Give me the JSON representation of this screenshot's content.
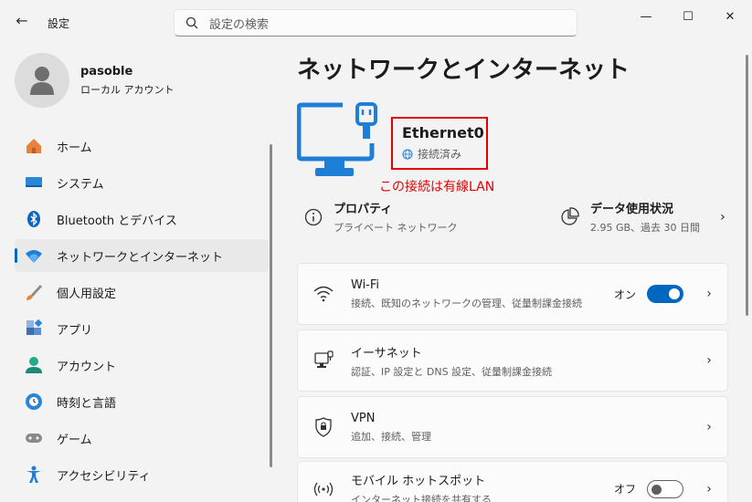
{
  "window": {
    "title": "設定",
    "back_icon": "arrow-left-icon",
    "minimize_icon": "minimize-icon",
    "maximize_icon": "maximize-icon",
    "close_icon": "close-icon"
  },
  "search": {
    "placeholder": "設定の検索",
    "icon": "search-icon"
  },
  "user": {
    "name": "pasoble",
    "account_type": "ローカル アカウント"
  },
  "nav": {
    "items": [
      {
        "label": "ホーム",
        "icon": "home-icon",
        "active": false
      },
      {
        "label": "システム",
        "icon": "system-icon",
        "active": false
      },
      {
        "label": "Bluetooth とデバイス",
        "icon": "bluetooth-icon",
        "active": false
      },
      {
        "label": "ネットワークとインターネット",
        "icon": "wifi-network-icon",
        "active": true
      },
      {
        "label": "個人用設定",
        "icon": "brush-icon",
        "active": false
      },
      {
        "label": "アプリ",
        "icon": "apps-icon",
        "active": false
      },
      {
        "label": "アカウント",
        "icon": "account-icon",
        "active": false
      },
      {
        "label": "時刻と言語",
        "icon": "clock-globe-icon",
        "active": false
      },
      {
        "label": "ゲーム",
        "icon": "gamepad-icon",
        "active": false
      },
      {
        "label": "アクセシビリティ",
        "icon": "accessibility-icon",
        "active": false
      }
    ]
  },
  "main": {
    "title": "ネットワークとインターネット",
    "connection": {
      "name": "Ethernet0",
      "status": "接続済み",
      "annotation": "この接続は有線LAN",
      "icon": "ethernet-monitor-icon",
      "status_icon": "globe-icon"
    },
    "properties": {
      "title": "プロパティ",
      "subtitle": "プライベート ネットワーク",
      "icon": "info-icon"
    },
    "data_usage": {
      "title": "データ使用状況",
      "subtitle": "2.95 GB、過去 30 日間",
      "icon": "pie-chart-icon"
    },
    "cards": [
      {
        "title": "Wi-Fi",
        "subtitle": "接続、既知のネットワークの管理、従量制課金接続",
        "icon": "wifi-icon",
        "toggle": "on",
        "toggle_label": "オン"
      },
      {
        "title": "イーサネット",
        "subtitle": "認証、IP 設定と DNS 設定、従量制課金接続",
        "icon": "ethernet-icon"
      },
      {
        "title": "VPN",
        "subtitle": "追加、接続、管理",
        "icon": "shield-icon"
      },
      {
        "title": "モバイル ホットスポット",
        "subtitle": "インターネット接続を共有する",
        "icon": "hotspot-icon",
        "toggle": "off",
        "toggle_label": "オフ"
      }
    ]
  },
  "colors": {
    "accent": "#0067c0",
    "annotation": "#e20000",
    "background": "#f3f3f3"
  }
}
